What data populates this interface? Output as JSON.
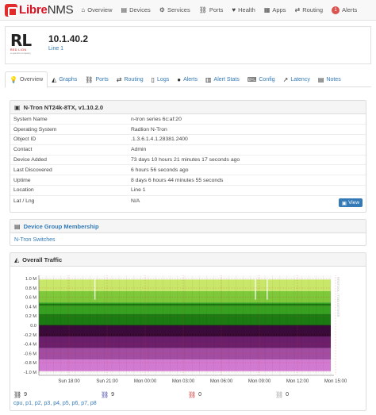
{
  "navbar": {
    "brand_main": "Libre",
    "brand_suffix": "NMS",
    "items": [
      {
        "icon": "home-icon",
        "label": "Overview"
      },
      {
        "icon": "server-icon",
        "label": "Devices"
      },
      {
        "icon": "cogs-icon",
        "label": "Services"
      },
      {
        "icon": "link-icon",
        "label": "Ports"
      },
      {
        "icon": "heartbeat-icon",
        "label": "Health"
      },
      {
        "icon": "apps-icon",
        "label": "Apps"
      },
      {
        "icon": "arrows-icon",
        "label": "Routing"
      },
      {
        "icon": "alert-badge",
        "label": "Alerts",
        "badge": "1"
      }
    ]
  },
  "device": {
    "logo_text": "RL",
    "logo_sub": "RED LION",
    "logo_sub2": "a spectris company",
    "hostname": "10.1.40.2",
    "location": "Line 1"
  },
  "tabs": [
    {
      "icon": "lightbulb-icon",
      "label": "Overview",
      "active": true
    },
    {
      "icon": "area-chart-icon",
      "label": "Graphs"
    },
    {
      "icon": "link-icon",
      "label": "Ports"
    },
    {
      "icon": "arrows-icon",
      "label": "Routing"
    },
    {
      "icon": "file-icon",
      "label": "Logs"
    },
    {
      "icon": "exclamation-circle-icon",
      "label": "Alerts"
    },
    {
      "icon": "bar-chart-icon",
      "label": "Alert Stats"
    },
    {
      "icon": "code-icon",
      "label": "Config"
    },
    {
      "icon": "line-chart-icon",
      "label": "Latency"
    },
    {
      "icon": "file-text-icon",
      "label": "Notes"
    }
  ],
  "overview": {
    "title": "N-Tron NT24k-8TX, v1.10.2.0",
    "rows": [
      {
        "key": "System Name",
        "value": "n-tron series 6c:af:20"
      },
      {
        "key": "Operating System",
        "value": "Radlion N-Tron"
      },
      {
        "key": "Object ID",
        "value": ".1.3.6.1.4.1.28381.2400"
      },
      {
        "key": "Contact",
        "value": "Admin"
      },
      {
        "key": "Device Added",
        "value": "73 days 10 hours 21 minutes 17 seconds ago"
      },
      {
        "key": "Last Discovered",
        "value": "6 hours 56 seconds ago"
      },
      {
        "key": "Uptime",
        "value": "8 days 6 hours 44 minutes 55 seconds"
      },
      {
        "key": "Location",
        "value": "Line 1"
      },
      {
        "key": "Lat / Lng",
        "value": "N/A"
      }
    ],
    "view_button": "View"
  },
  "membership": {
    "title": "Device Group Membership",
    "group": "N-Tron Switches"
  },
  "traffic": {
    "title": "Overall Traffic",
    "watermark": "RRDTOOL / TOBI OETIKER",
    "ports_up": "9",
    "ports_total": "9",
    "ports_down": "0",
    "ports_disabled": "0",
    "port_list": "cpu, p1, p2, p3, p4, p5, p6, p7, p8"
  },
  "chart_data": {
    "type": "area",
    "title": "",
    "ylabel": "",
    "y_ticks": [
      "1.0 M",
      "0.8 M",
      "0.6 M",
      "0.4 M",
      "0.2 M",
      "0.0",
      "-0.2 M",
      "-0.4 M",
      "-0.6 M",
      "-0.8 M",
      "-1.0 M"
    ],
    "y_tick_values": [
      1.0,
      0.8,
      0.6,
      0.4,
      0.2,
      0.0,
      -0.2,
      -0.4,
      -0.6,
      -0.8,
      -1.0
    ],
    "ylim": [
      -1.07,
      1.07
    ],
    "x_ticks": [
      "Sun 18:00",
      "Sun 21:00",
      "Mon 00:00",
      "Mon 03:00",
      "Mon 06:00",
      "Mon 09:00",
      "Mon 12:00",
      "Mon 15:00"
    ],
    "series": [
      {
        "name": "in",
        "direction": "up",
        "value": 0.98,
        "colors": [
          "#1b7a12",
          "#36a120",
          "#7ec83a",
          "#c9e86a"
        ]
      },
      {
        "name": "out",
        "direction": "down",
        "value": -0.98,
        "colors": [
          "#3a0a3a",
          "#6b1f6b",
          "#a24da2",
          "#d27ad2"
        ]
      }
    ],
    "grid": true
  }
}
